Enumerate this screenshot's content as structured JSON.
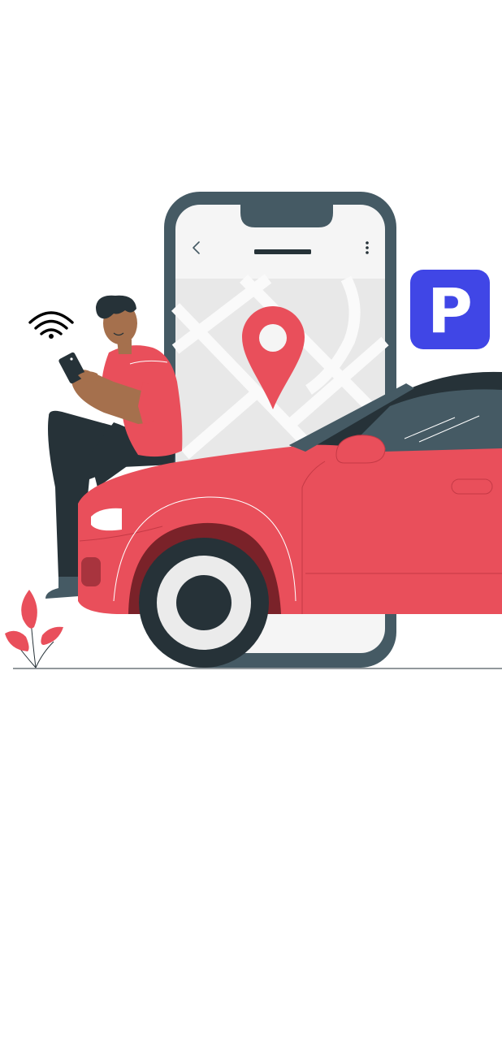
{
  "screen": {
    "background": "#ffffff"
  },
  "parking_sign": {
    "label": "P",
    "color": "#4046e6"
  },
  "phone_mockup": {
    "back_icon": "chevron-left-icon",
    "menu_icon": "more-vertical-icon",
    "map_pin_icon": "location-pin-icon",
    "frame_color": "#455a64",
    "pin_color": "#e94f5b"
  },
  "car": {
    "body_color": "#e94f5b"
  },
  "wifi": {
    "icon": "wifi-icon"
  }
}
